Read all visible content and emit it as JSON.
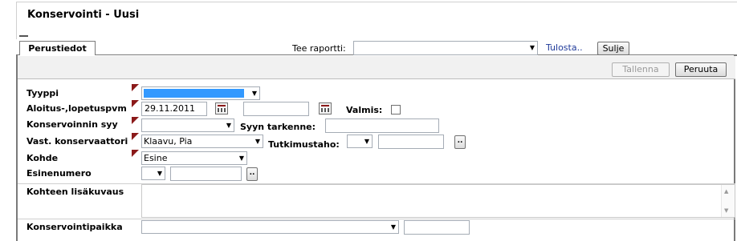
{
  "page": {
    "title": "Konservointi  - Uusi"
  },
  "tabs": [
    {
      "label": "Perustiedot"
    }
  ],
  "report": {
    "label": "Tee raportti:",
    "selected": "",
    "print_link": "Tulosta..",
    "close_button": "Sulje"
  },
  "toolbar": {
    "save_label": "Tallenna",
    "cancel_label": "Peruuta"
  },
  "form": {
    "type_label": "Tyyppi",
    "type_value": "",
    "dates_label": "Aloitus-,lopetuspvm",
    "start_date": "29.11.2011",
    "end_date": "",
    "done_label": "Valmis:",
    "reason_label": "Konservoinnin syy",
    "reason_value": "",
    "reason_detail_label": "Syyn tarkenne:",
    "reason_detail_value": "",
    "conservator_label": "Vast. konservaattori",
    "conservator_value": "Klaavu, Pia",
    "research_label": "Tutkimustaho:",
    "research_value": "",
    "target_label": "Kohde",
    "target_value": "Esine",
    "object_number_label": "Esinenumero",
    "object_number_value": "",
    "description_label": "Kohteen lisäkuvaus",
    "description_value": "",
    "location_label": "Konservointipaikka",
    "location_value": "",
    "browse_label": ".."
  }
}
